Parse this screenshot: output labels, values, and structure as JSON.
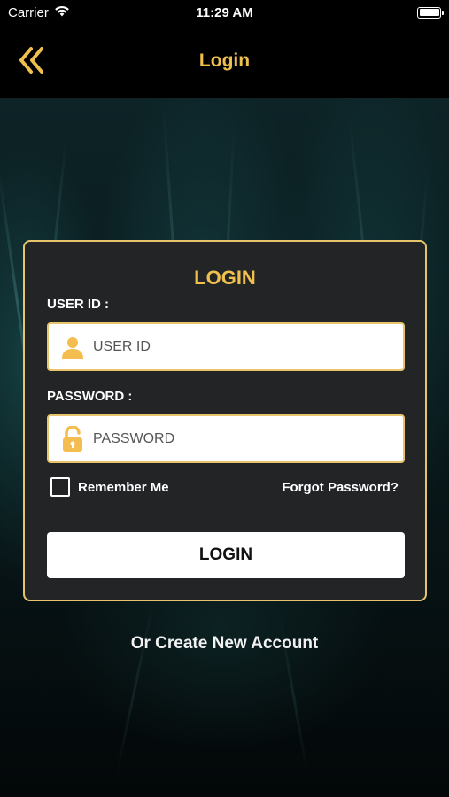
{
  "status_bar": {
    "carrier": "Carrier",
    "time": "11:29 AM",
    "icons": [
      "wifi-icon",
      "battery-icon"
    ]
  },
  "nav": {
    "title": "Login",
    "back_icon": "double-chevron-left-icon"
  },
  "card": {
    "title": "LOGIN",
    "user_id_label": "USER ID :",
    "user_id_placeholder": "USER ID",
    "user_icon": "user-icon",
    "password_label": "PASSWORD :",
    "password_placeholder": "PASSWORD",
    "password_icon": "unlock-icon",
    "remember_label": "Remember Me",
    "remember_checked": false,
    "forgot_label": "Forgot Password?",
    "login_button": "LOGIN"
  },
  "create_account": "Or Create New Account",
  "colors": {
    "accent": "#f0c04e",
    "border": "#e7c46c",
    "card_bg": "#222426",
    "page_bg": "#000000"
  }
}
